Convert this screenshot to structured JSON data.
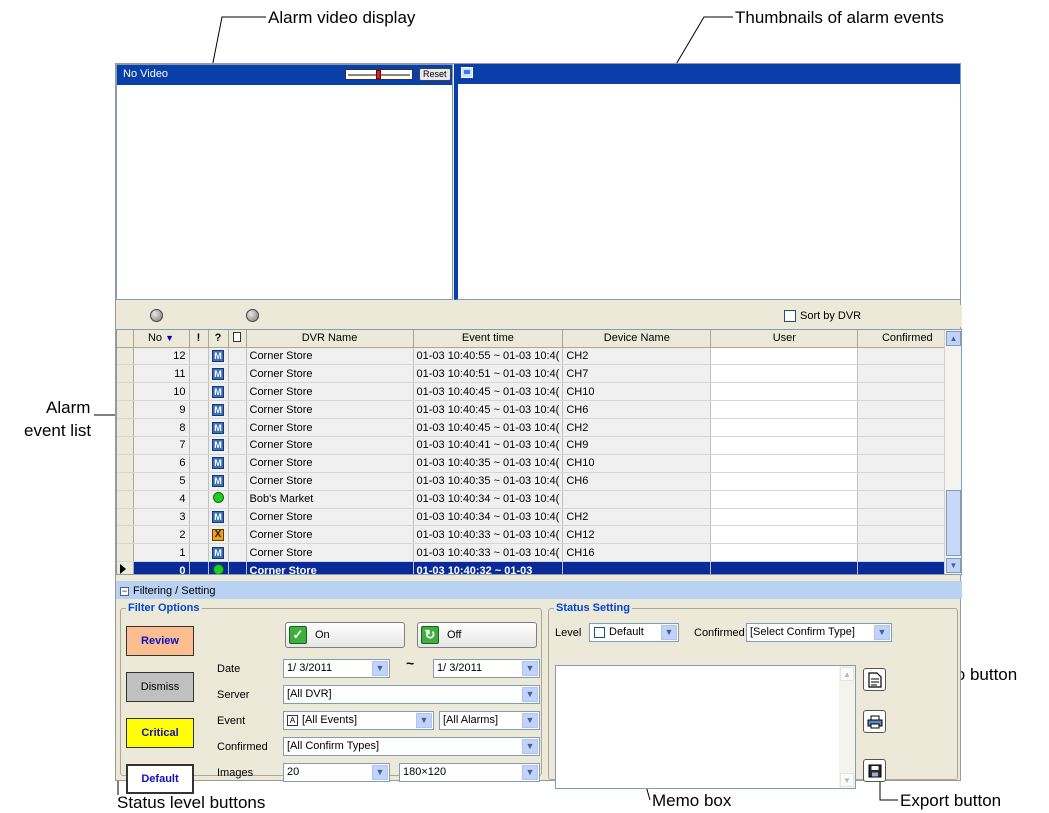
{
  "callouts": {
    "alarm_video": "Alarm video display",
    "thumbnails": "Thumbnails of alarm events",
    "event_list_line1": "Alarm",
    "event_list_line2": "event list",
    "memo_button": "Memo button",
    "status_level_buttons": "Status level buttons",
    "memo_box": "Memo box",
    "export_button": "Export button"
  },
  "video": {
    "status": "No Video",
    "reset_label": "Reset"
  },
  "toolbar": {
    "sort_by_dvr": "Sort by DVR"
  },
  "table": {
    "headers": [
      "No",
      "!",
      "?",
      "",
      "DVR Name",
      "Event time",
      "Device Name",
      "User",
      "Confirmed"
    ],
    "rows": [
      {
        "no": "12",
        "icon": "M",
        "dvr": "Corner Store",
        "time": "01-03 10:40:55 ~ 01-03 10:4(",
        "device": "CH2",
        "user": "",
        "confirmed": ""
      },
      {
        "no": "11",
        "icon": "M",
        "dvr": "Corner Store",
        "time": "01-03 10:40:51 ~ 01-03 10:4(",
        "device": "CH7",
        "user": "",
        "confirmed": ""
      },
      {
        "no": "10",
        "icon": "M",
        "dvr": "Corner Store",
        "time": "01-03 10:40:45 ~ 01-03 10:4(",
        "device": "CH10",
        "user": "",
        "confirmed": ""
      },
      {
        "no": "9",
        "icon": "M",
        "dvr": "Corner Store",
        "time": "01-03 10:40:45 ~ 01-03 10:4(",
        "device": "CH6",
        "user": "",
        "confirmed": ""
      },
      {
        "no": "8",
        "icon": "M",
        "dvr": "Corner Store",
        "time": "01-03 10:40:45 ~ 01-03 10:4(",
        "device": "CH2",
        "user": "",
        "confirmed": ""
      },
      {
        "no": "7",
        "icon": "M",
        "dvr": "Corner Store",
        "time": "01-03 10:40:41 ~ 01-03 10:4(",
        "device": "CH9",
        "user": "",
        "confirmed": ""
      },
      {
        "no": "6",
        "icon": "M",
        "dvr": "Corner Store",
        "time": "01-03 10:40:35 ~ 01-03 10:4(",
        "device": "CH10",
        "user": "",
        "confirmed": ""
      },
      {
        "no": "5",
        "icon": "M",
        "dvr": "Corner Store",
        "time": "01-03 10:40:35 ~ 01-03 10:4(",
        "device": "CH6",
        "user": "",
        "confirmed": ""
      },
      {
        "no": "4",
        "icon": "dot",
        "dvr": "Bob's Market",
        "time": "01-03 10:40:34 ~ 01-03 10:4(",
        "device": "",
        "user": "",
        "confirmed": ""
      },
      {
        "no": "3",
        "icon": "M",
        "dvr": "Corner Store",
        "time": "01-03 10:40:34 ~ 01-03 10:4(",
        "device": "CH2",
        "user": "",
        "confirmed": ""
      },
      {
        "no": "2",
        "icon": "X",
        "dvr": "Corner Store",
        "time": "01-03 10:40:33 ~ 01-03 10:4(",
        "device": "CH12",
        "user": "",
        "confirmed": ""
      },
      {
        "no": "1",
        "icon": "M",
        "dvr": "Corner Store",
        "time": "01-03 10:40:33 ~ 01-03 10:4(",
        "device": "CH16",
        "user": "",
        "confirmed": ""
      },
      {
        "no": "0",
        "icon": "dot",
        "dvr": "Corner Store",
        "time": "01-03 10:40:32 ~ 01-03",
        "device": "",
        "user": "",
        "confirmed": ""
      }
    ]
  },
  "section_title": "Filtering / Setting",
  "filter": {
    "legend": "Filter Options",
    "levels": {
      "review": "Review",
      "dismiss": "Dismiss",
      "critical": "Critical",
      "default": "Default"
    },
    "on_label": "On",
    "off_label": "Off",
    "date_label": "Date",
    "date_from": "1/ 3/2011",
    "date_tilde": "~",
    "date_to": "1/ 3/2011",
    "server_label": "Server",
    "server_value": "[All DVR]",
    "event_label": "Event",
    "event_value": "[All Events]",
    "alarm_value": "[All Alarms]",
    "confirmed_label": "Confirmed",
    "confirmed_value": "[All Confirm Types]",
    "images_label": "Images",
    "images_count": "20",
    "images_size": "180×120"
  },
  "status": {
    "legend": "Status Setting",
    "level_label": "Level",
    "level_value": "Default",
    "confirmed_label": "Confirmed",
    "confirmed_value": "[Select Confirm Type]"
  },
  "colors": {
    "title_blue": "#0a3ea8",
    "selected_row": "#0a2a9a",
    "review_bg": "#fbbf8f",
    "critical_bg": "#ffff00",
    "dismiss_bg": "#c0c0c0",
    "default_bg": "#ffffff"
  }
}
